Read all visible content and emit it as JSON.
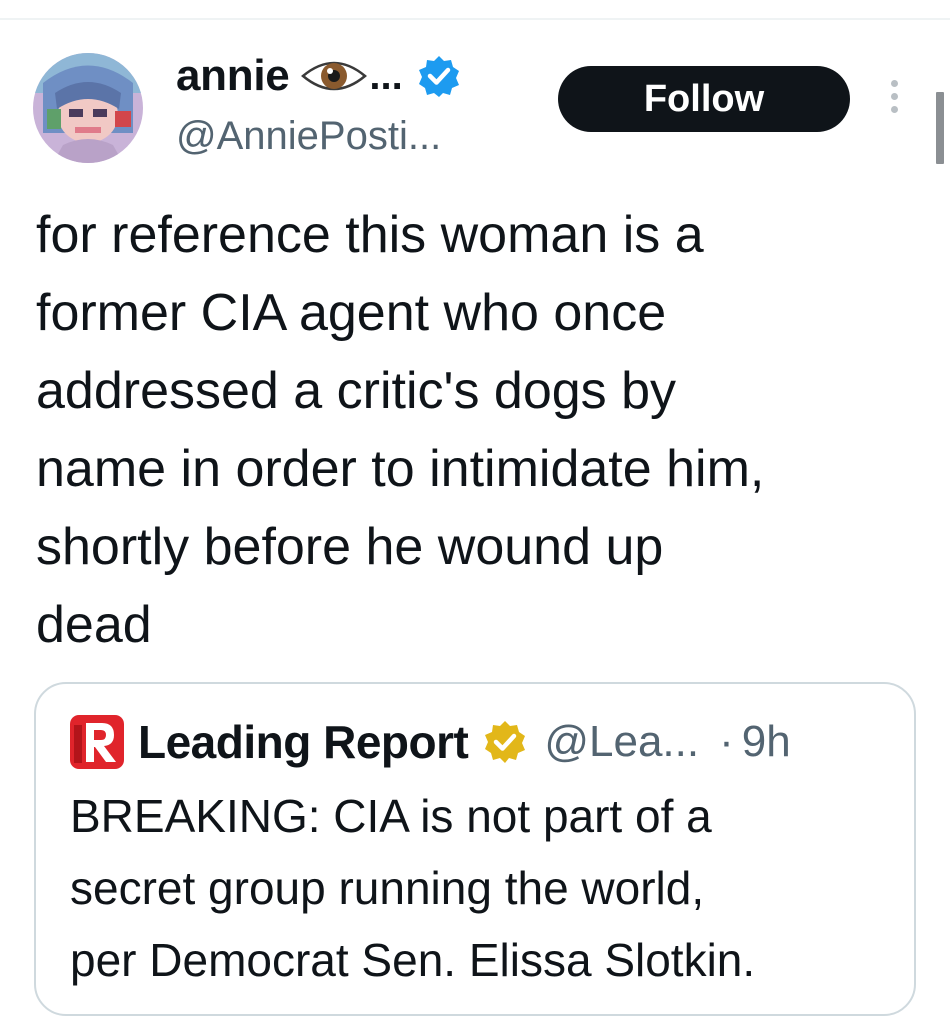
{
  "post": {
    "author": {
      "display_name": "annie",
      "name_ellipsis": "...",
      "handle": "@AnniePosti...",
      "avatar": "avatar-image",
      "verified_icon": "verified-check-icon",
      "emoji_icon": "eye-icon"
    },
    "follow_label": "Follow",
    "text": "for reference this woman is a\nformer CIA agent who once\naddressed a critic's dogs by\nname in order to intimidate him,\nshortly before he wound up\ndead"
  },
  "quote": {
    "logo_icon": "leading-report-logo-icon",
    "name": "Leading Report",
    "badge_icon": "gold-verified-badge-icon",
    "handle": "@Lea...",
    "separator": "·",
    "time": "9h",
    "text": "BREAKING: CIA is not part of a\nsecret group running the world,\nper Democrat Sen. Elissa Slotkin."
  },
  "colors": {
    "follow_bg": "#0f1419",
    "verified_blue": "#1d9bf0",
    "secondary_text": "#536471",
    "card_border": "#cfd9de",
    "gold_badge": "#e2b719",
    "logo_red": "#e0242b"
  }
}
